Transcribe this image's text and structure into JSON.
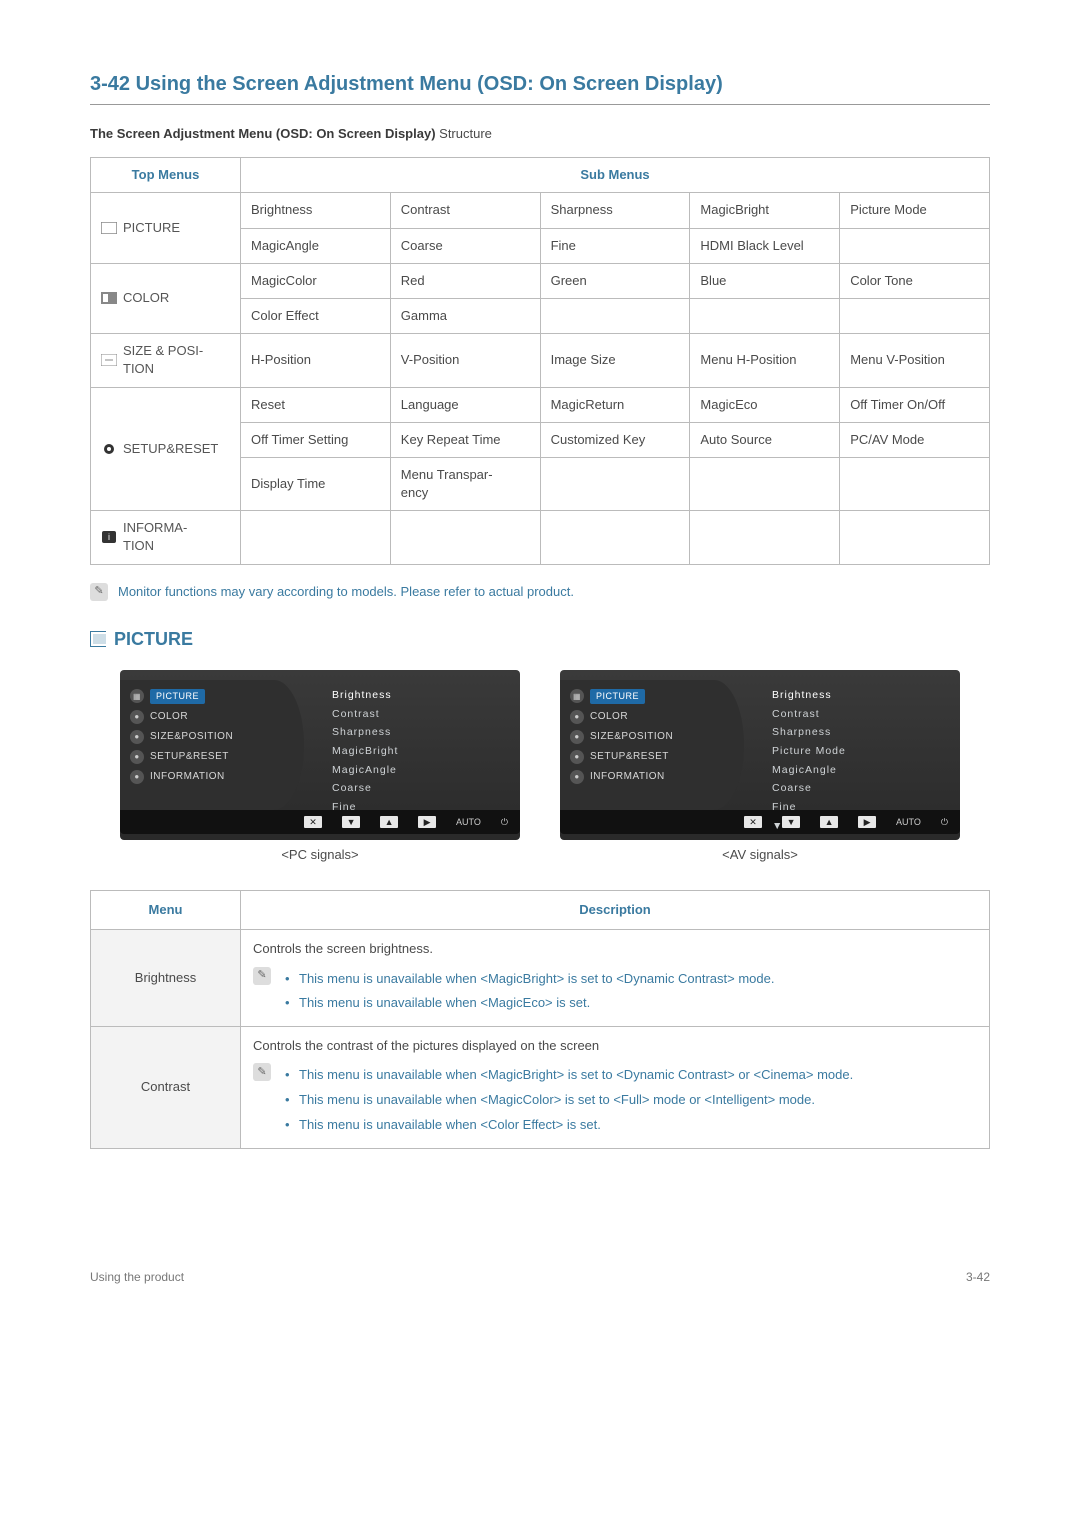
{
  "page": {
    "title": "3-42  Using the Screen Adjustment Menu (OSD: On Screen Display)",
    "subtitle_bold": "The Screen Adjustment Menu (OSD: On Screen Display)",
    "subtitle_rest": " Structure",
    "footer_left": "Using the product",
    "footer_right": "3-42"
  },
  "struct_table": {
    "header_top": "Top Menus",
    "header_sub": "Sub Menus",
    "rows": [
      {
        "top": "PICTURE",
        "icon": "picture-icon",
        "rowspan": 2,
        "cells": [
          [
            "Brightness",
            "Contrast",
            "Sharpness",
            "MagicBright",
            "Picture Mode"
          ],
          [
            "MagicAngle",
            "Coarse",
            "Fine",
            "HDMI Black Level",
            ""
          ]
        ]
      },
      {
        "top": "COLOR",
        "icon": "color-icon",
        "rowspan": 2,
        "cells": [
          [
            "MagicColor",
            "Red",
            "Green",
            "Blue",
            "Color Tone"
          ],
          [
            "Color Effect",
            "Gamma",
            "",
            "",
            ""
          ]
        ]
      },
      {
        "top": "SIZE & POSI-TION",
        "icon": "size-icon",
        "rowspan": 1,
        "cells": [
          [
            "H-Position",
            "V-Position",
            "Image Size",
            "Menu H-Position",
            "Menu V-Position"
          ]
        ]
      },
      {
        "top": "SETUP&RESET",
        "icon": "setup-icon",
        "rowspan": 3,
        "cells": [
          [
            "Reset",
            "Language",
            "MagicReturn",
            "MagicEco",
            "Off Timer On/Off"
          ],
          [
            "Off Timer Setting",
            "Key Repeat Time",
            "Customized Key",
            "Auto Source",
            "PC/AV Mode"
          ],
          [
            "Display Time",
            "Menu Transpar-ency",
            "",
            "",
            ""
          ]
        ]
      },
      {
        "top": "INFORMA-TION",
        "icon": "info-icon",
        "rowspan": 1,
        "cells": [
          [
            "",
            "",
            "",
            "",
            ""
          ]
        ]
      }
    ]
  },
  "note1": "Monitor functions may vary according to models. Please refer to actual product.",
  "section_picture": "PICTURE",
  "osd": {
    "left_items": [
      "PICTURE",
      "COLOR",
      "SIZE&POSITION",
      "SETUP&RESET",
      "INFORMATION"
    ],
    "right_pc": [
      "Brightness",
      "Contrast",
      "Sharpness",
      "MagicBright",
      "MagicAngle",
      "Coarse",
      "Fine"
    ],
    "right_av": [
      "Brightness",
      "Contrast",
      "Sharpness",
      "Picture Mode",
      "MagicAngle",
      "Coarse",
      "Fine"
    ],
    "caption_pc": "<PC signals>",
    "caption_av": "<AV signals>",
    "auto": "AUTO"
  },
  "desc_table": {
    "header_menu": "Menu",
    "header_desc": "Description",
    "rows": [
      {
        "menu": "Brightness",
        "lead": "Controls the screen brightness.",
        "notes": [
          "This menu is unavailable when <MagicBright> is set to <Dynamic Contrast> mode.",
          "This menu is unavailable when <MagicEco> is set."
        ]
      },
      {
        "menu": "Contrast",
        "lead": "Controls the contrast of the pictures displayed on the screen",
        "notes": [
          "This menu is unavailable when <MagicBright> is set to <Dynamic Contrast> or <Cinema> mode.",
          "This menu is unavailable when <MagicColor> is set to <Full> mode or <Intelligent> mode.",
          "This menu is unavailable when <Color Effect> is set."
        ]
      }
    ]
  }
}
